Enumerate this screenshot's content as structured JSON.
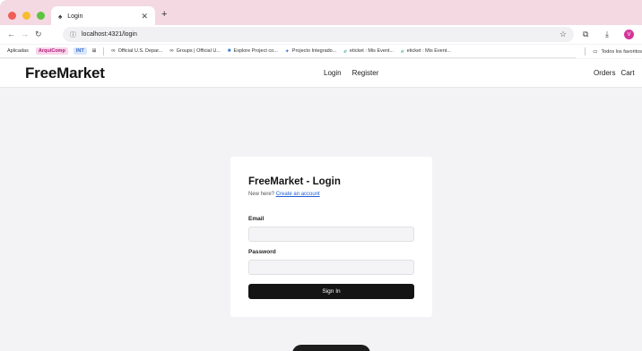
{
  "browser": {
    "tab": {
      "title": "Login"
    },
    "address": {
      "url": "localhost:4321/login"
    },
    "bookmarks": [
      {
        "label": "Aplicadas",
        "kind": "text"
      },
      {
        "label": "ArquiComp",
        "kind": "chip-pink"
      },
      {
        "label": "INT",
        "kind": "chip-blue"
      },
      {
        "label": "Official U.S. Depar...",
        "kind": "link"
      },
      {
        "label": "Groups | Official U...",
        "kind": "link"
      },
      {
        "label": "Explore Project co...",
        "kind": "link"
      },
      {
        "label": "Projecto Integrado...",
        "kind": "link"
      },
      {
        "label": "eticket : Mis Event...",
        "kind": "link"
      },
      {
        "label": "eticket : Mis Event...",
        "kind": "link"
      }
    ],
    "all_bookmarks": "Todos los favoritos",
    "profile_initial": "V"
  },
  "app": {
    "brand": "FreeMarket",
    "nav": {
      "login": "Login",
      "register": "Register",
      "orders": "Orders",
      "cart": "Cart"
    }
  },
  "login": {
    "title": "FreeMarket - Login",
    "subtitle_prefix": "New here?",
    "subtitle_link": "Create an account",
    "email_label": "Email",
    "email_value": "",
    "password_label": "Password",
    "password_value": "",
    "submit_label": "Sign In"
  },
  "colors": {
    "tabstrip": "#f4d9e2",
    "page_bg": "#f3f3f5",
    "primary_button": "#141414",
    "link": "#1f5fd1"
  }
}
